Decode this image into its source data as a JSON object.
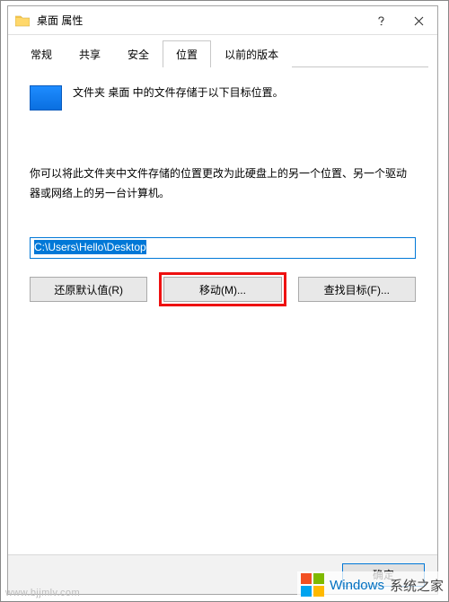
{
  "window": {
    "title": "桌面 属性"
  },
  "tabs": {
    "general": "常规",
    "sharing": "共享",
    "security": "安全",
    "location": "位置",
    "previous": "以前的版本"
  },
  "location_tab": {
    "heading": "文件夹 桌面 中的文件存储于以下目标位置。",
    "paragraph": "你可以将此文件夹中文件存储的位置更改为此硬盘上的另一个位置、另一个驱动器或网络上的另一台计算机。",
    "path_value": "C:\\Users\\Hello\\Desktop",
    "restore_default": "还原默认值(R)",
    "move": "移动(M)...",
    "find_target": "查找目标(F)..."
  },
  "footer": {
    "ok": "确定"
  },
  "watermark": {
    "brand": "Windows",
    "suffix": "系统之家",
    "url": "www.bjjmlv.com"
  }
}
